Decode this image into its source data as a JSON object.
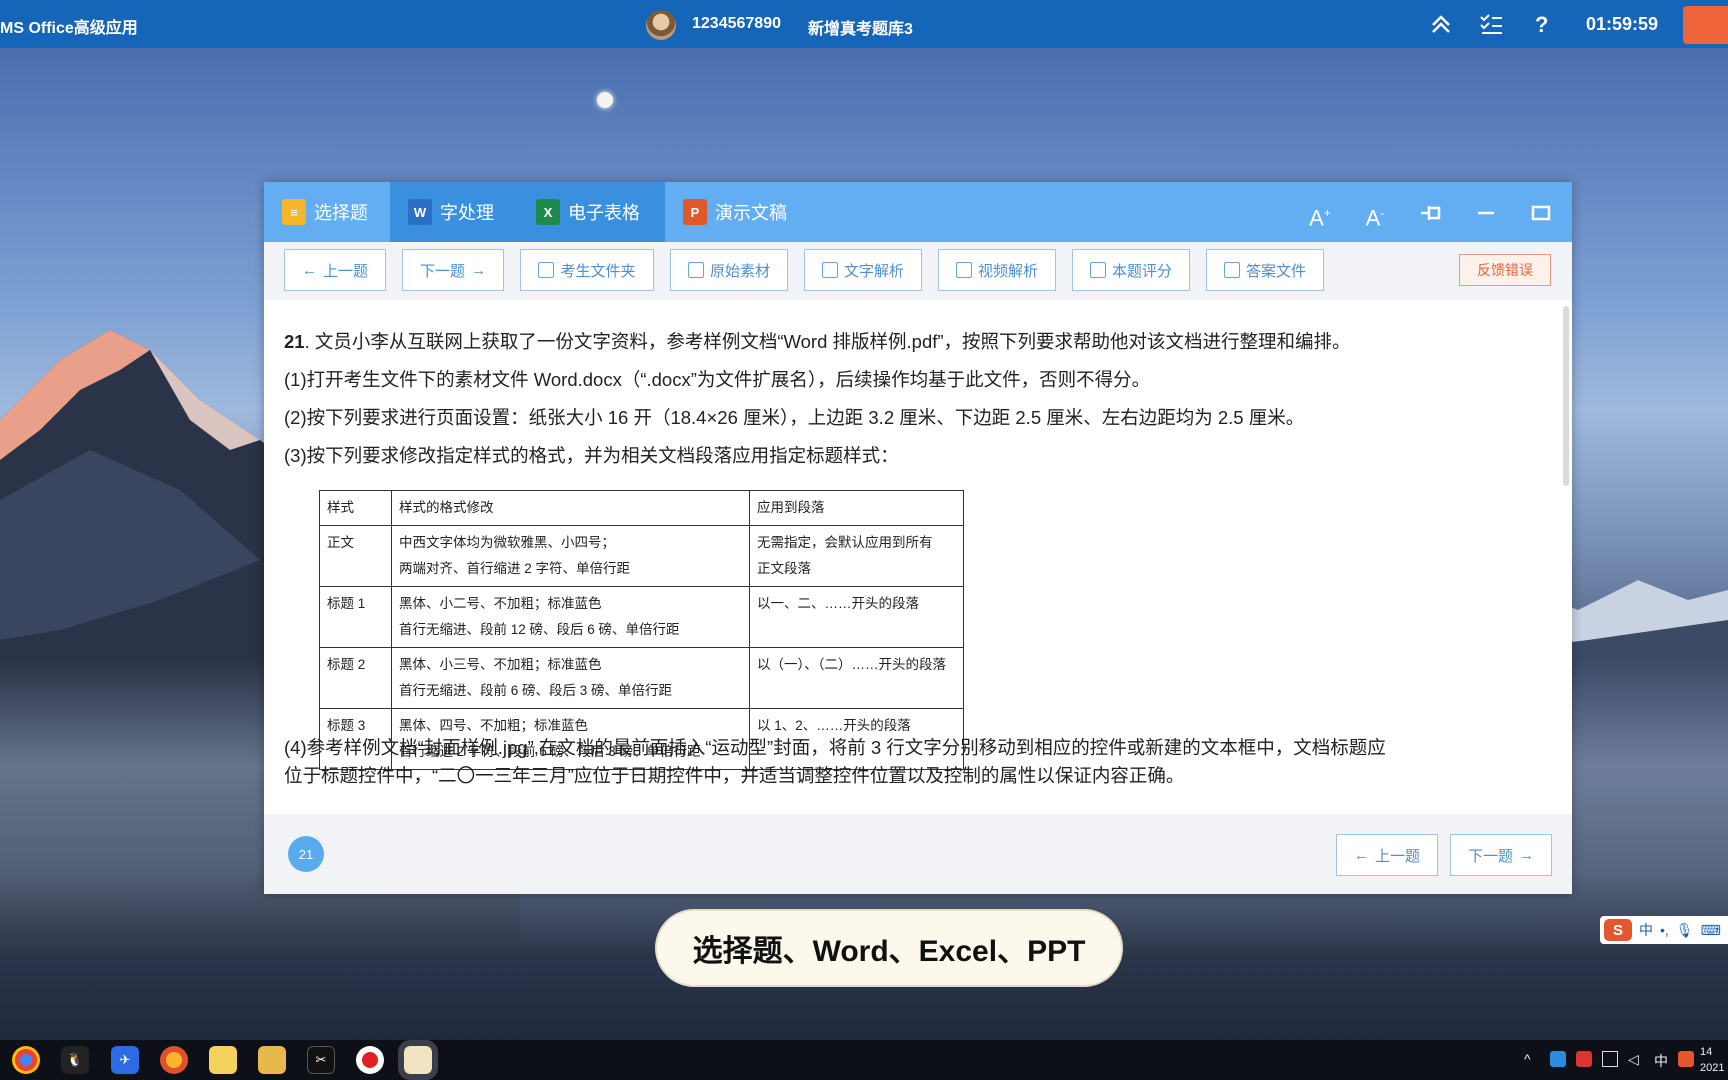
{
  "topbar": {
    "app_title": "MS Office高级应用",
    "candidate_id": "1234567890",
    "bank_name": "新增真考题库3",
    "timer": "01:59:59"
  },
  "tabs": [
    {
      "label": "选择题",
      "icon": "document-icon",
      "color": "#f5b729"
    },
    {
      "label": "字处理",
      "icon": "word-icon",
      "color": "#2b6fc7"
    },
    {
      "label": "电子表格",
      "icon": "excel-icon",
      "color": "#1e8b4d"
    },
    {
      "label": "演示文稿",
      "icon": "ppt-icon",
      "color": "#e0592b"
    }
  ],
  "toolbar": {
    "prev": "上一题",
    "next": "下一题",
    "student_folder": "考生文件夹",
    "original_material": "原始素材",
    "text_analysis": "文字解析",
    "video_analysis": "视频解析",
    "score": "本题评分",
    "answer_file": "答案文件",
    "feedback": "反馈错误"
  },
  "question": {
    "number": "21",
    "intro": ". 文员小李从互联网上获取了一份文字资料，参考样例文档“Word 排版样例.pdf”，按照下列要求帮助他对该文档进行整理和编排。",
    "step1": "(1)打开考生文件下的素材文件 Word.docx（“.docx”为文件扩展名），后续操作均基于此文件，否则不得分。",
    "step2": "(2)按下列要求进行页面设置：纸张大小 16 开（18.4×26 厘米），上边距 3.2 厘米、下边距 2.5 厘米、左右边距均为 2.5 厘米。",
    "step3": "(3)按下列要求修改指定样式的格式，并为相关文档段落应用指定标题样式：",
    "step4_line1": "(4)参考样例文档“封面样例.jpg”,在文档的最前面插入“运动型”封面，将前 3 行文字分别移动到相应的控件或新建的文本框中，文档标题应",
    "step4_line2": "位于标题控件中，“二〇一三年三月”应位于日期控件中，并适当调整控件位置以及控制的属性以保证内容正确。"
  },
  "style_table": {
    "headers": [
      "样式",
      "样式的格式修改",
      "应用到段落"
    ],
    "rows": [
      {
        "style": "正文",
        "mod1": "中西文字体均为微软雅黑、小四号；",
        "mod2": "两端对齐、首行缩进 2 字符、单倍行距",
        "apply1": "无需指定，会默认应用到所有",
        "apply2": "正文段落"
      },
      {
        "style": "标题 1",
        "mod1": "黑体、小二号、不加粗；标准蓝色",
        "mod2": "首行无缩进、段前 12 磅、段后 6 磅、单倍行距",
        "apply1": "以一、二、……开头的段落",
        "apply2": ""
      },
      {
        "style": "标题 2",
        "mod1": "黑体、小三号、不加粗；标准蓝色",
        "mod2": "首行无缩进、段前 6 磅、段后 3 磅、单倍行距",
        "apply1": "以（一）、（二）……开头的段落",
        "apply2": ""
      },
      {
        "style": "标题 3",
        "mod1": "黑体、四号、不加粗；标准蓝色",
        "mod2": "首行缩进 2 字符、段前 6 磅、段后 3 磅、单倍行距",
        "apply1": "以 1、2、……开头的段落",
        "apply2": ""
      }
    ]
  },
  "footer": {
    "current_question": "21",
    "prev": "上一题",
    "next": "下一题"
  },
  "caption": "选择题、Word、Excel、PPT",
  "ime": {
    "mode": "中"
  },
  "taskbar": {
    "apps": [
      "chrome-icon",
      "qq-icon",
      "feishu-icon",
      "firefox-icon",
      "notes-icon",
      "folder-icon",
      "capcut-icon",
      "recorder-icon",
      "exam-app-icon"
    ],
    "tray_ime": "中",
    "clock_time": "14",
    "clock_year": "2021"
  }
}
